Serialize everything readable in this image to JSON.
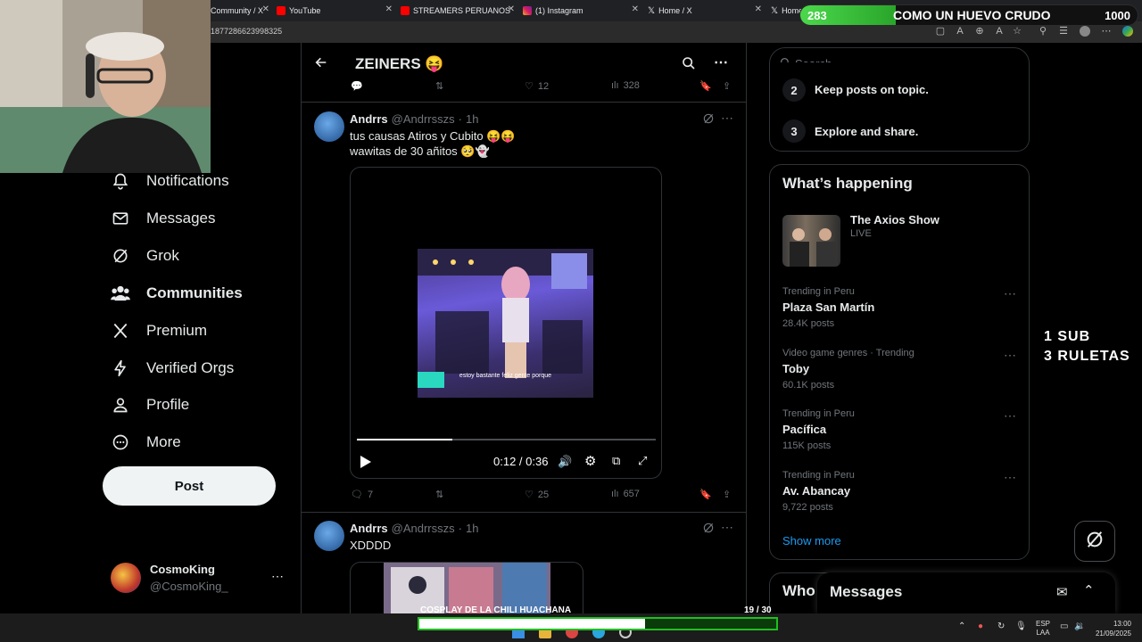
{
  "browser": {
    "tabs": [
      {
        "label": "Community / X"
      },
      {
        "label": "YouTube"
      },
      {
        "label": "STREAMERS PERUANOS"
      },
      {
        "label": "(1) Instagram"
      },
      {
        "label": "Home / X"
      },
      {
        "label": "Home"
      }
    ],
    "url_fragment": "1877286623998325"
  },
  "nav": {
    "items": [
      {
        "label": "Notifications",
        "icon": "bell-icon"
      },
      {
        "label": "Messages",
        "icon": "envelope-icon"
      },
      {
        "label": "Grok",
        "icon": "grok-icon"
      },
      {
        "label": "Communities",
        "icon": "people-icon"
      },
      {
        "label": "Premium",
        "icon": "x-logo-icon"
      },
      {
        "label": "Verified Orgs",
        "icon": "lightning-icon"
      },
      {
        "label": "Profile",
        "icon": "person-icon"
      },
      {
        "label": "More",
        "icon": "more-circle-icon"
      }
    ],
    "post_label": "Post",
    "account": {
      "name": "CosmoKing",
      "handle": "@CosmoKing_"
    }
  },
  "header": {
    "title": "ZEINERS 😝"
  },
  "top_actions": {
    "likes": "12",
    "views": "328"
  },
  "posts": [
    {
      "name": "Andrrs",
      "handle": "@Andrrsszs",
      "time": "1h",
      "line1": "tus causas Atiros y Cubito 😝😝",
      "line2": "wawitas de 30 añitos 🥺👻",
      "video_caption": "estoy bastante feliz gente porque",
      "video_time": "0:12 / 0:36",
      "progress": 0.32,
      "replies": "7",
      "likes": "25",
      "views": "657"
    },
    {
      "name": "Andrrs",
      "handle": "@Andrrsszs",
      "time": "1h",
      "line1": "XDDDD"
    }
  ],
  "right": {
    "search_placeholder": "Search",
    "rules": [
      {
        "num": "2",
        "text": "Keep posts on topic."
      },
      {
        "num": "3",
        "text": "Explore and share."
      }
    ],
    "happening_title": "What’s happening",
    "featured": {
      "title": "The Axios Show",
      "status": "LIVE"
    },
    "trends": [
      {
        "context": "Trending in Peru",
        "name": "Plaza San Martín",
        "count": "28.4K posts"
      },
      {
        "context": "Video game genres · Trending",
        "name": "Toby",
        "count": "60.1K posts"
      },
      {
        "context": "Trending in Peru",
        "name": "Pacífica",
        "count": "115K posts"
      },
      {
        "context": "Trending in Peru",
        "name": "Av. Abancay",
        "count": "9,722 posts"
      }
    ],
    "show_more": "Show more",
    "who_to_follow": "Who",
    "messages_title": "Messages"
  },
  "overlay": {
    "goal_current": "283",
    "goal_text": "COMO UN HUEVO CRUDO",
    "goal_target": "1000",
    "goal_fraction": 0.283,
    "sub_line1": "1 SUB",
    "sub_line2": "3 RULETAS",
    "bottom_label": "COSPLAY DE LA CHILI HUACHANA",
    "bottom_count": "19 / 30",
    "bottom_fraction": 0.633
  },
  "taskbar": {
    "lang1": "ESP",
    "lang2": "LAA",
    "time": "13:00",
    "date": "21/09/2025"
  },
  "colors": {
    "accent": "#1d9bf0",
    "goal_green": "#3fd13f",
    "bar_green": "#1fbf1f"
  }
}
